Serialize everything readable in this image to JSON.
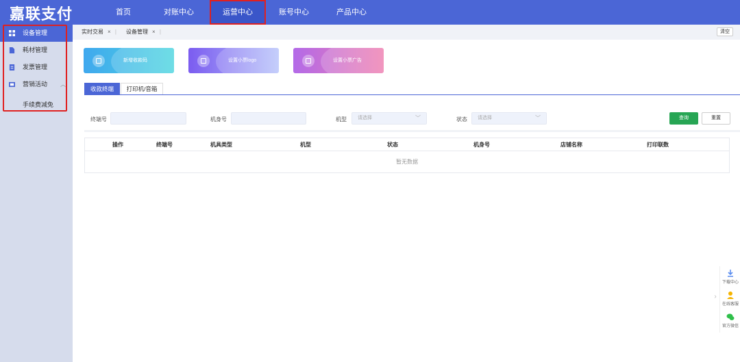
{
  "app": {
    "logo": "嘉联支付"
  },
  "nav": {
    "items": [
      {
        "label": "首页"
      },
      {
        "label": "对账中心"
      },
      {
        "label": "运营中心"
      },
      {
        "label": "账号中心"
      },
      {
        "label": "产品中心"
      }
    ],
    "active": "运营中心"
  },
  "sidebar": {
    "items": [
      {
        "label": "设备管理",
        "icon": "grid-icon"
      },
      {
        "label": "耗材管理",
        "icon": "file-icon"
      },
      {
        "label": "发票管理",
        "icon": "invoice-icon"
      },
      {
        "label": "营销活动",
        "icon": "promo-icon"
      }
    ],
    "sub_item": "手续费减免"
  },
  "tabs": {
    "items": [
      {
        "label": "实时交易",
        "close": "×"
      },
      {
        "label": "设备管理",
        "close": "×"
      }
    ],
    "clear_label": "清空"
  },
  "cards": [
    {
      "label": "新增收款码",
      "icon": "qrcode-icon"
    },
    {
      "label": "设置小票logo",
      "icon": "image-icon"
    },
    {
      "label": "设置小票广告",
      "icon": "ad-icon"
    }
  ],
  "subtabs": [
    {
      "label": "收款终端"
    },
    {
      "label": "打印机/音箱"
    }
  ],
  "filters": {
    "terminal_label": "终端号",
    "sn_label": "机身号",
    "model_label": "机型",
    "model_placeholder": "请选择",
    "status_label": "状态",
    "status_placeholder": "请选择",
    "query_label": "查询",
    "reset_label": "重置"
  },
  "table": {
    "columns": [
      "操作",
      "终端号",
      "机具类型",
      "机型",
      "状态",
      "机身号",
      "店铺名称",
      "打印联数"
    ],
    "empty_text": "暂无数据"
  },
  "float_panel": {
    "items": [
      {
        "label": "下载中心"
      },
      {
        "label": "在线客服"
      },
      {
        "label": "官方微信"
      }
    ],
    "arrow": "›"
  },
  "colors": {
    "primary": "#4b66d6",
    "success": "#27a554",
    "highlight": "#e02020",
    "card1": "#3fb4e8",
    "card2": "#7b5cf0",
    "card3": "#c66be8"
  }
}
